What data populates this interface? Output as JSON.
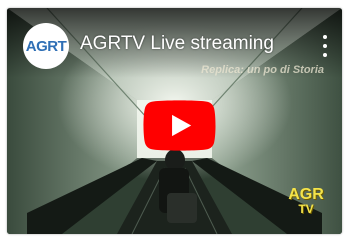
{
  "video": {
    "title": "AGRTV Live streaming",
    "overlay_caption": "Replica: un po di Storia",
    "channel_avatar_text": "AGRT",
    "watermark_top": "AGR",
    "watermark_bottom": "TV"
  },
  "icons": {
    "play": "youtube-play-icon",
    "menu": "more-vert-icon"
  },
  "colors": {
    "play_red": "#ff0000",
    "watermark_yellow": "#f3e34a",
    "avatar_blue": "#2f6fb5"
  }
}
